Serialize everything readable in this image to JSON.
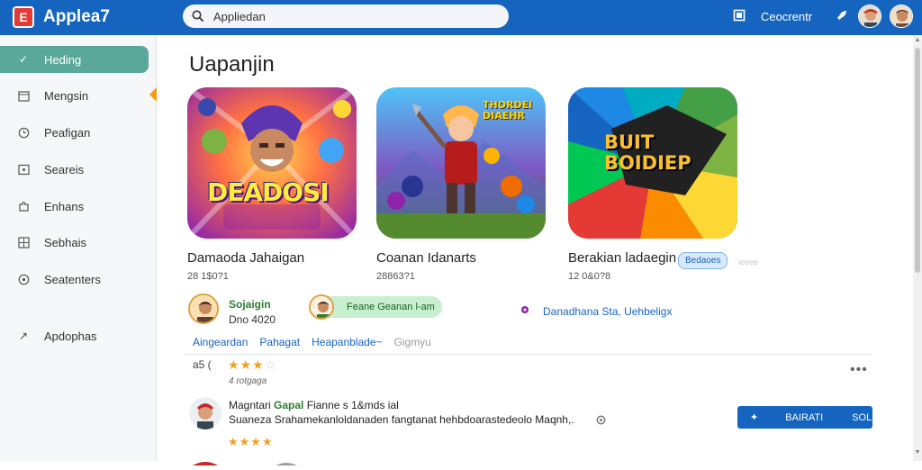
{
  "header": {
    "app_title": "Applea7",
    "search_value": "Appliedan",
    "link": "Ceocrentr"
  },
  "sidebar": {
    "items": [
      {
        "label": "Heding",
        "icon": "check-icon",
        "active": true
      },
      {
        "label": "Mengsin",
        "icon": "calendar-icon",
        "active": false
      },
      {
        "label": "Peafigan",
        "icon": "clock-icon",
        "active": false
      },
      {
        "label": "Seareis",
        "icon": "image-icon",
        "active": false
      },
      {
        "label": "Enhans",
        "icon": "puzzle-icon",
        "active": false
      },
      {
        "label": "Sebhais",
        "icon": "grid-icon",
        "active": false
      },
      {
        "label": "Seatenters",
        "icon": "settings-icon",
        "active": false
      },
      {
        "label": "Apdophas",
        "icon": "expand-icon",
        "active": false
      }
    ]
  },
  "main": {
    "page_title": "Uapanjin",
    "cards": [
      {
        "title": "Damaoda Jahaigan",
        "sub": "28 1$0?1",
        "art_text": "DEADOSI"
      },
      {
        "title": "Coanan Idanarts",
        "sub": "28863?1",
        "art_text": "THORDEI DIAEHR"
      },
      {
        "title": "Berakian ladaegin",
        "sub": "12 0&0?8",
        "art_text": "BUIT BOIDIEP",
        "badge": "Bedaoes",
        "badge_faint": "ieeee"
      }
    ],
    "author": {
      "name": "Sojaigin",
      "date": "Dno 4020",
      "pill_label": "Feane Geanan l-am",
      "meta": "Danadhana Sta, Uehbeligx"
    },
    "tabs": [
      "Aingeardan",
      "Pahagat",
      "Heapanblade~",
      "Gigmyu"
    ],
    "rating": {
      "prefix": "a5 (",
      "stars": 3.5,
      "note": "4 rotgaga"
    },
    "review": {
      "name": "Magntari",
      "name_green": "Gapal",
      "meta": "Fianne  s  1&mds  ial",
      "body": "Suaneza Srahamekanloldanaden fangtanat hehbdoarastedeolo Maqnh,.",
      "stars": 4,
      "cta_icon": "pin-icon",
      "cta_label": "BAIRATI",
      "cta_label2": "SOLL"
    }
  },
  "colors": {
    "topbar": "#1565c0",
    "active_sidebar": "#5aa89a",
    "link": "#1565c0",
    "stars": "#f0a020"
  }
}
